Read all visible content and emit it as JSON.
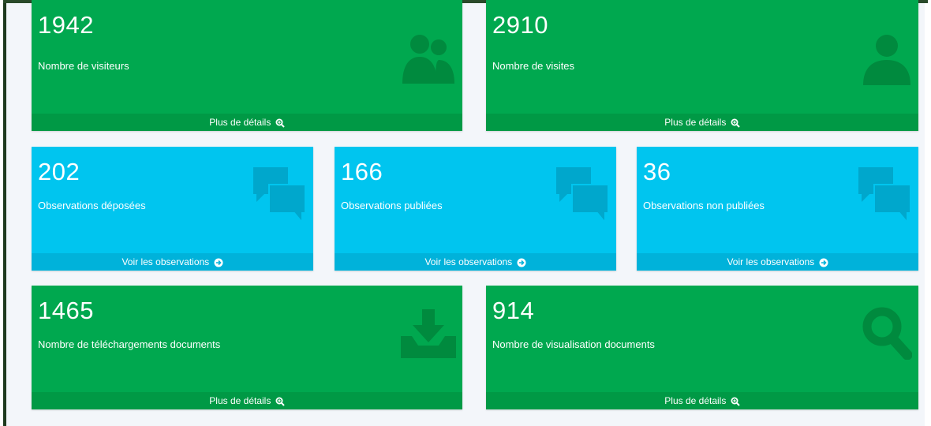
{
  "colors": {
    "green": "#00a84f",
    "green_footer": "#009945",
    "green_icon": "#008a3e",
    "aqua": "#00c5ef",
    "aqua_footer": "#00b2da",
    "aqua_icon": "#00a7cc"
  },
  "boxes": {
    "visiteurs": {
      "value": "1942",
      "label": "Nombre de visiteurs",
      "link": "Plus de détails",
      "icon": "users-icon",
      "link_icon": "zoom-in-icon"
    },
    "visites": {
      "value": "2910",
      "label": "Nombre de visites",
      "link": "Plus de détails",
      "icon": "user-icon",
      "link_icon": "zoom-in-icon"
    },
    "deposees": {
      "value": "202",
      "label": "Observations déposées",
      "link": "Voir les observations",
      "icon": "comments-icon",
      "link_icon": "arrow-circle-right-icon"
    },
    "publiees": {
      "value": "166",
      "label": "Observations publiées",
      "link": "Voir les observations",
      "icon": "comments-icon",
      "link_icon": "arrow-circle-right-icon"
    },
    "non_publiees": {
      "value": "36",
      "label": "Observations non publiées",
      "link": "Voir les observations",
      "icon": "comments-icon",
      "link_icon": "arrow-circle-right-icon"
    },
    "telechargements": {
      "value": "1465",
      "label": "Nombre de téléchargements documents",
      "link": "Plus de détails",
      "icon": "download-icon",
      "link_icon": "zoom-in-icon"
    },
    "visualisation": {
      "value": "914",
      "label": "Nombre de visualisation documents",
      "link": "Plus de détails",
      "icon": "search-icon",
      "link_icon": "zoom-in-icon"
    }
  }
}
